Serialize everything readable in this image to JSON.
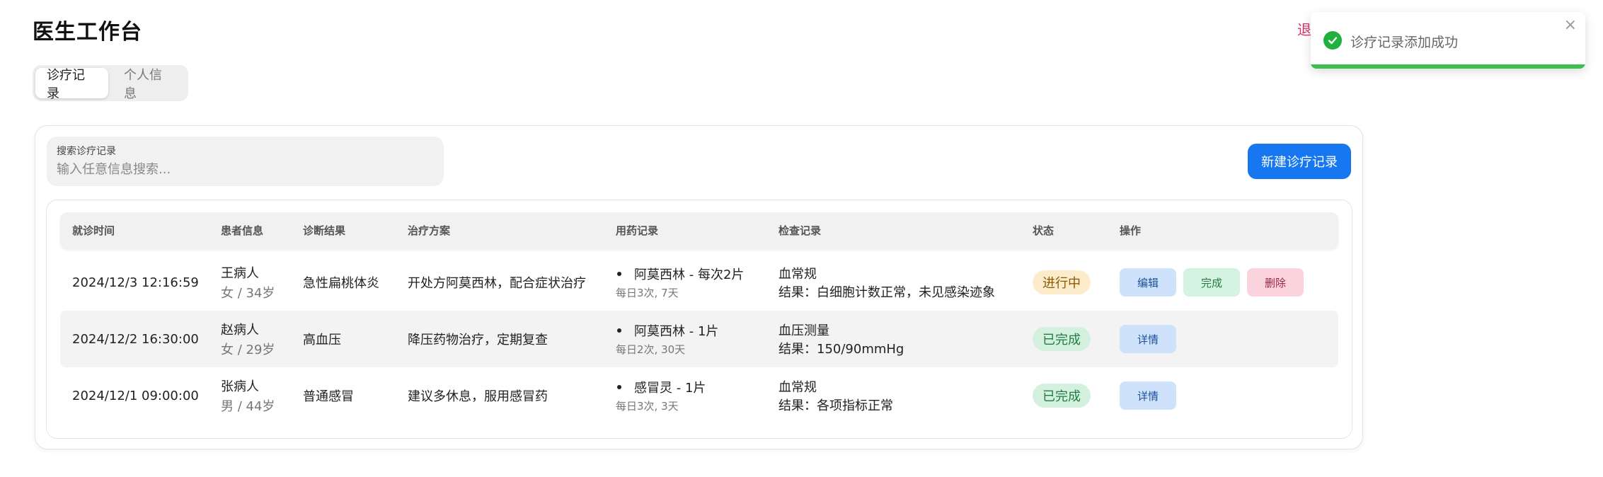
{
  "header": {
    "title": "医生工作台",
    "logout_label": "退"
  },
  "tabs": [
    {
      "label": "诊疗记录",
      "active": true
    },
    {
      "label": "个人信息",
      "active": false
    }
  ],
  "search": {
    "label": "搜索诊疗记录",
    "placeholder": "输入任意信息搜索...",
    "value": ""
  },
  "new_button_label": "新建诊疗记录",
  "table": {
    "columns": [
      "就诊时间",
      "患者信息",
      "诊断结果",
      "治疗方案",
      "用药记录",
      "检查记录",
      "状态",
      "操作"
    ],
    "rows": [
      {
        "time": "2024/12/3 12:16:59",
        "patient_name": "王病人",
        "patient_info": "女 / 34岁",
        "diagnosis": "急性扁桃体炎",
        "treatment": "开处方阿莫西林，配合症状治疗",
        "medication": "阿莫西林 - 每次2片",
        "medication_note": "每日3次, 7天",
        "exam": "血常规",
        "exam_result": "结果：白细胞计数正常，未见感染迹象",
        "status": "进行中",
        "actions": [
          "编辑",
          "完成",
          "删除"
        ]
      },
      {
        "time": "2024/12/2 16:30:00",
        "patient_name": "赵病人",
        "patient_info": "女 / 29岁",
        "diagnosis": "高血压",
        "treatment": "降压药物治疗，定期复查",
        "medication": "阿莫西林 - 1片",
        "medication_note": "每日2次, 30天",
        "exam": "血压测量",
        "exam_result": "结果：150/90mmHg",
        "status": "已完成",
        "actions": [
          "详情"
        ]
      },
      {
        "time": "2024/12/1 09:00:00",
        "patient_name": "张病人",
        "patient_info": "男 / 44岁",
        "diagnosis": "普通感冒",
        "treatment": "建议多休息，服用感冒药",
        "medication": "感冒灵 - 1片",
        "medication_note": "每日3次, 3天",
        "exam": "血常规",
        "exam_result": "结果：各项指标正常",
        "status": "已完成",
        "actions": [
          "详情"
        ]
      }
    ]
  },
  "toast": {
    "message": "诊疗记录添加成功",
    "icon": "check-circle-icon",
    "close_icon": "close-icon"
  },
  "colors": {
    "primary": "#1677f0",
    "success_icon": "#1fb040",
    "toast_bar": "#3bbf4f",
    "status_in_progress_bg": "#fdeccb",
    "status_in_progress_text": "#8a5a00",
    "status_done_bg": "#d4f1df",
    "status_done_text": "#237a44",
    "edit_bg": "#cfe2fb",
    "edit_text": "#1b4f9a",
    "complete_bg": "#d5f3e1",
    "complete_text": "#2a7a48",
    "delete_bg": "#fbd3df",
    "delete_text": "#9a2747",
    "logout": "#d6336c"
  }
}
